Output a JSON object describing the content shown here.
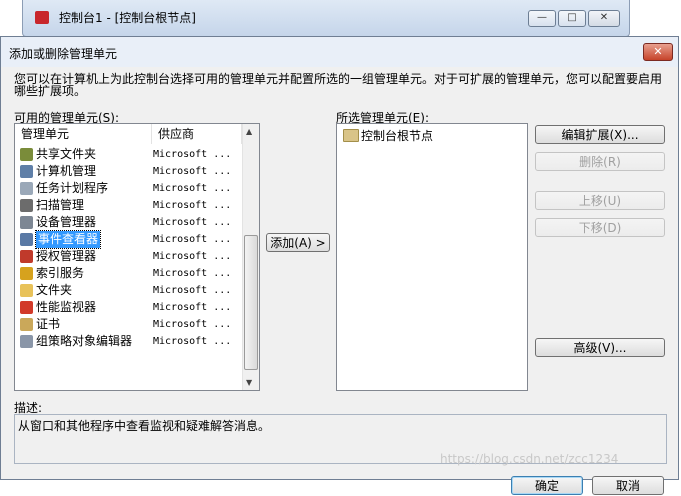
{
  "bg_window": {
    "title": "控制台1 - [控制台根节点]",
    "min": "—",
    "max": "□",
    "close": "✕"
  },
  "dialog": {
    "title": "添加或删除管理单元",
    "close": "✕",
    "intro": "您可以在计算机上为此控制台选择可用的管理单元并配置所选的一组管理单元。对于可扩展的管理单元，您可以配置要启用哪些扩展项。",
    "available_label": "可用的管理单元(S):",
    "selected_label": "所选管理单元(E):",
    "columns": [
      "管理单元",
      "供应商"
    ],
    "snapins": [
      {
        "name": "共享文件夹",
        "vendor": "Microsoft ...",
        "icon": "shared-folder-icon",
        "color": "#7a8c3a"
      },
      {
        "name": "计算机管理",
        "vendor": "Microsoft ...",
        "icon": "computer-management-icon",
        "color": "#5f7fa8"
      },
      {
        "name": "任务计划程序",
        "vendor": "Microsoft ...",
        "icon": "clock-icon",
        "color": "#9aa8b8"
      },
      {
        "name": "扫描管理",
        "vendor": "Microsoft ...",
        "icon": "scanner-icon",
        "color": "#6c6c6c"
      },
      {
        "name": "设备管理器",
        "vendor": "Microsoft ...",
        "icon": "device-manager-icon",
        "color": "#7d8794"
      },
      {
        "name": "事件查看器",
        "vendor": "Microsoft ...",
        "icon": "event-viewer-icon",
        "color": "#5a79a5",
        "selected": true
      },
      {
        "name": "授权管理器",
        "vendor": "Microsoft ...",
        "icon": "authorization-icon",
        "color": "#c03a2b"
      },
      {
        "name": "索引服务",
        "vendor": "Microsoft ...",
        "icon": "indexing-icon",
        "color": "#d6a21e"
      },
      {
        "name": "文件夹",
        "vendor": "Microsoft ...",
        "icon": "folder-icon",
        "color": "#e8c25a"
      },
      {
        "name": "性能监视器",
        "vendor": "Microsoft ...",
        "icon": "performance-icon",
        "color": "#d23a2a"
      },
      {
        "name": "证书",
        "vendor": "Microsoft ...",
        "icon": "certificate-icon",
        "color": "#caa85a"
      },
      {
        "name": "组策略对象编辑器",
        "vendor": "Microsoft ...",
        "icon": "group-policy-icon",
        "color": "#8a96a8"
      }
    ],
    "selected_tree": {
      "root": "控制台根节点"
    },
    "buttons": {
      "add": "添加(A) >",
      "edit_ext": "编辑扩展(X)...",
      "remove": "删除(R)",
      "up": "上移(U)",
      "down": "下移(D)",
      "advanced": "高级(V)...",
      "ok": "确定",
      "cancel": "取消"
    },
    "desc_label": "描述:",
    "desc_text": "从窗口和其他程序中查看监视和疑难解答消息。"
  },
  "watermark": "https://blog.csdn.net/zcc1234"
}
